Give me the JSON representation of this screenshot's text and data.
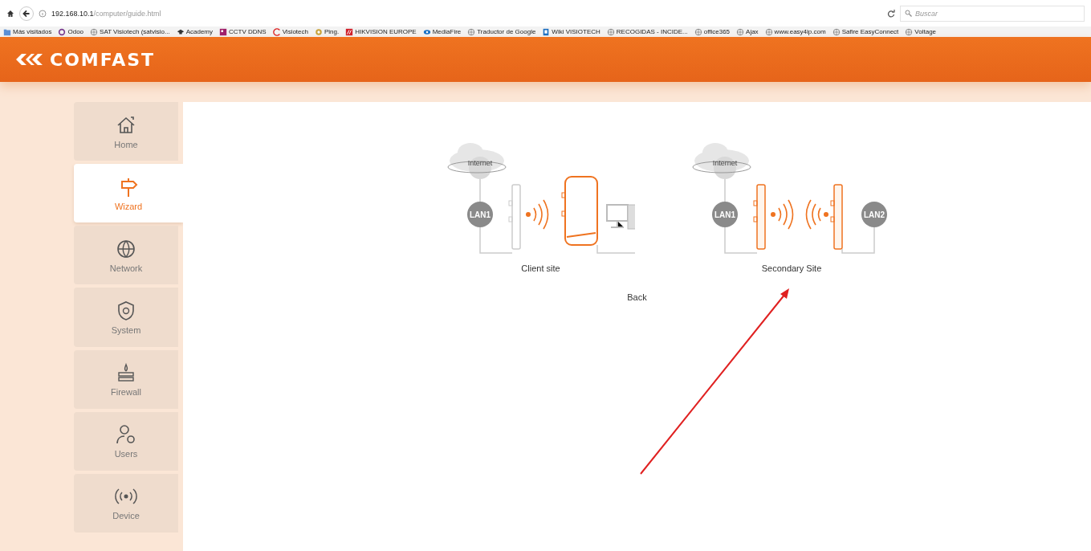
{
  "browser": {
    "url_host": "192.168.10.1",
    "url_path": "/computer/guide.html",
    "search_placeholder": "Buscar",
    "bookmarks": [
      {
        "label": "Más visitados",
        "kind": "folder"
      },
      {
        "label": "Odoo",
        "kind": "ring"
      },
      {
        "label": "SAT Visiotech (satvisio...",
        "kind": "globe"
      },
      {
        "label": "Academy",
        "kind": "cap"
      },
      {
        "label": "CCTV DDNS",
        "kind": "tile"
      },
      {
        "label": "Visiotech",
        "kind": "arc"
      },
      {
        "label": "Ping.",
        "kind": "badge"
      },
      {
        "label": "HIKVISION EUROPE",
        "kind": "hik"
      },
      {
        "label": "MediaFire",
        "kind": "fire"
      },
      {
        "label": "Traductor de Google",
        "kind": "globe"
      },
      {
        "label": "Wiki VISIOTECH",
        "kind": "doc"
      },
      {
        "label": "RECOGIDAS - INCIDE...",
        "kind": "globe"
      },
      {
        "label": "office365",
        "kind": "globe"
      },
      {
        "label": "Ajax",
        "kind": "globe"
      },
      {
        "label": "www.easy4ip.com",
        "kind": "globe"
      },
      {
        "label": "Safire EasyConnect",
        "kind": "globe"
      },
      {
        "label": "Voltage",
        "kind": "globe"
      }
    ]
  },
  "header": {
    "brand": "COMFAST"
  },
  "sidebar": {
    "items": [
      {
        "label": "Home",
        "kind": "home",
        "selected": false
      },
      {
        "label": "Wizard",
        "kind": "signpost",
        "selected": true
      },
      {
        "label": "Network",
        "kind": "globe",
        "selected": false
      },
      {
        "label": "System",
        "kind": "shield",
        "selected": false
      },
      {
        "label": "Firewall",
        "kind": "firewall",
        "selected": false
      },
      {
        "label": "Users",
        "kind": "users",
        "selected": false
      },
      {
        "label": "Device",
        "kind": "antenna",
        "selected": false
      }
    ]
  },
  "wizard": {
    "options": [
      {
        "kind": "client",
        "caption": "Client site",
        "cloud_label": "Internet",
        "lan_labels": [
          "LAN1"
        ]
      },
      {
        "kind": "bridge",
        "caption": "Secondary Site",
        "cloud_label": "Internet",
        "lan_labels": [
          "LAN1",
          "LAN2"
        ]
      }
    ],
    "back": "Back"
  }
}
